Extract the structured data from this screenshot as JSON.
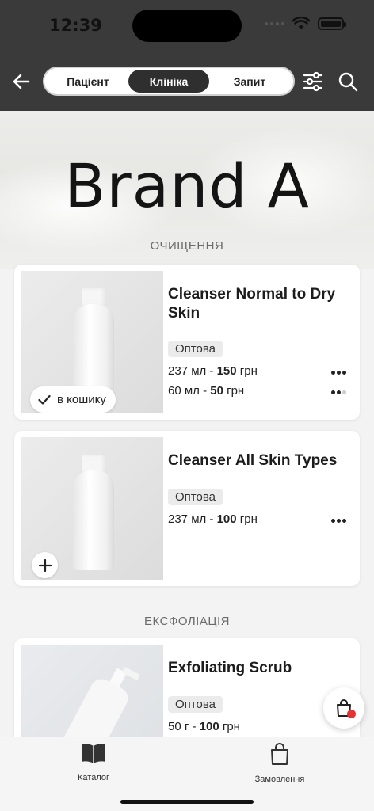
{
  "status": {
    "time": "12:39"
  },
  "segments": [
    {
      "label": "Пацієнт",
      "active": false
    },
    {
      "label": "Клініка",
      "active": true
    },
    {
      "label": "Запит",
      "active": false
    }
  ],
  "brand": {
    "title": "Brand A"
  },
  "sections": [
    {
      "title": "ОЧИЩЕННЯ"
    },
    {
      "title": "ЕКСФОЛІАЦІЯ"
    }
  ],
  "products": [
    {
      "name": "Cleanser Normal to Dry Skin",
      "tag": "Оптова",
      "prices": [
        {
          "size": "237 мл - ",
          "price": "150",
          "currency": " грн"
        },
        {
          "size": "60 мл - ",
          "price": "50",
          "currency": " грн"
        }
      ],
      "cart_label": "в кошику"
    },
    {
      "name": "Cleanser All Skin Types",
      "tag": "Оптова",
      "prices": [
        {
          "size": "237 мл - ",
          "price": "100",
          "currency": " грн"
        }
      ]
    },
    {
      "name": "Exfoliating Scrub",
      "tag": "Оптова",
      "prices": [
        {
          "size": "50 г - ",
          "price": "100",
          "currency": " грн"
        }
      ]
    }
  ],
  "tabbar": {
    "catalog": "Каталог",
    "orders": "Замовлення"
  },
  "colors": {
    "header": "#3a3a3a",
    "accent_badge": "#e53333"
  },
  "icons": [
    "back-arrow-icon",
    "filter-sliders-icon",
    "search-icon",
    "checkmark-icon",
    "plus-icon",
    "shopping-bag-icon",
    "book-icon",
    "more-dots-icon"
  ]
}
